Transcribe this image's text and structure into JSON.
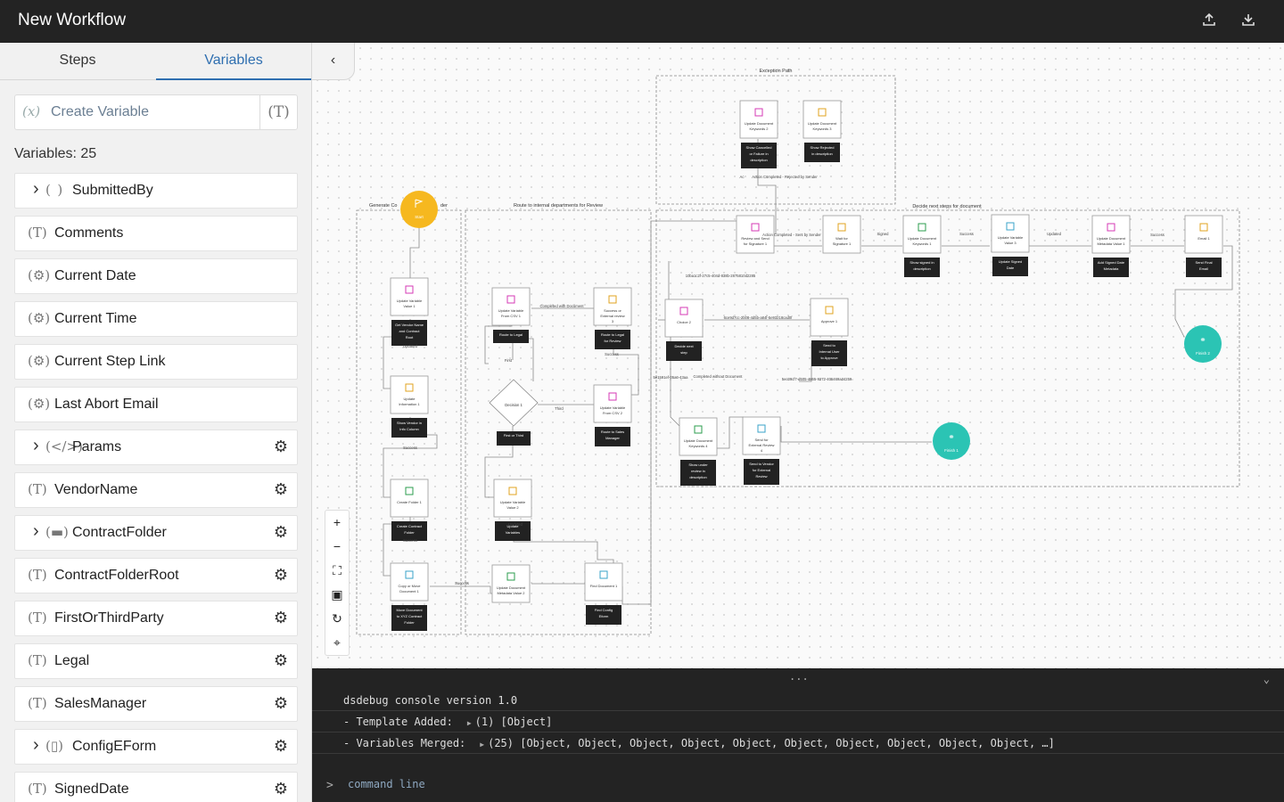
{
  "header": {
    "title": "New Workflow",
    "upload_icon": "upload-icon",
    "download_icon": "download-icon"
  },
  "sidebar": {
    "tabs": [
      {
        "label": "Steps"
      },
      {
        "label": "Variables"
      }
    ],
    "active_tab": "Variables",
    "create_variable": {
      "placeholder": "Create Variable",
      "prefix": "(x)",
      "type_button": "(T)"
    },
    "count_label": "Variables: 25",
    "variables": [
      {
        "name": "SubmittedBy",
        "icon": "( )",
        "icon_name": "person-icon",
        "expandable": true,
        "gear": false
      },
      {
        "name": "Comments",
        "icon": "(T)",
        "icon_name": "text-type-icon",
        "expandable": false,
        "gear": false
      },
      {
        "name": "Current Date",
        "icon": "(⚙)",
        "icon_name": "system-variable-icon",
        "expandable": false,
        "gear": false
      },
      {
        "name": "Current Time",
        "icon": "(⚙)",
        "icon_name": "system-variable-icon",
        "expandable": false,
        "gear": false
      },
      {
        "name": "Current Step Link",
        "icon": "(⚙)",
        "icon_name": "system-variable-icon",
        "expandable": false,
        "gear": false
      },
      {
        "name": "Last Abort Email",
        "icon": "(⚙)",
        "icon_name": "system-variable-icon",
        "expandable": false,
        "gear": false
      },
      {
        "name": "Params",
        "icon": "(</>)",
        "icon_name": "code-icon",
        "expandable": true,
        "gear": true
      },
      {
        "name": "VendorName",
        "icon": "(T)",
        "icon_name": "text-type-icon",
        "expandable": false,
        "gear": true
      },
      {
        "name": "ContractFolder",
        "icon": "(▬)",
        "icon_name": "folder-icon",
        "expandable": true,
        "gear": true
      },
      {
        "name": "ContractFolderRoot",
        "icon": "(T)",
        "icon_name": "text-type-icon",
        "expandable": false,
        "gear": true
      },
      {
        "name": "FirstOrThirdParty",
        "icon": "(T)",
        "icon_name": "text-type-icon",
        "expandable": false,
        "gear": true
      },
      {
        "name": "Legal",
        "icon": "(T)",
        "icon_name": "text-type-icon",
        "expandable": false,
        "gear": true
      },
      {
        "name": "SalesManager",
        "icon": "(T)",
        "icon_name": "text-type-icon",
        "expandable": false,
        "gear": true
      },
      {
        "name": "ConfigEForm",
        "icon": "(▯)",
        "icon_name": "form-icon",
        "expandable": true,
        "gear": true
      },
      {
        "name": "SignedDate",
        "icon": "(T)",
        "icon_name": "text-type-icon",
        "expandable": false,
        "gear": true
      }
    ]
  },
  "canvas": {
    "zoom_controls": [
      {
        "glyph": "+",
        "name": "zoom-in-button"
      },
      {
        "glyph": "−",
        "name": "zoom-out-button"
      },
      {
        "glyph": "⛶",
        "name": "fit-view-button"
      },
      {
        "glyph": "▣",
        "name": "lock-button"
      },
      {
        "glyph": "↻",
        "name": "reset-button"
      },
      {
        "glyph": "⌖",
        "name": "locate-button"
      }
    ],
    "groups": [
      "Exception Path",
      "Generate Co",
      "der",
      "Route to internal departments for Review",
      "Decide next steps for document"
    ],
    "nodes": [
      {
        "title": "Start",
        "desc": ""
      },
      {
        "title": "Update Variable Value 1",
        "desc": "Get Vendor Name and Contract Root"
      },
      {
        "title": "Update Information 1",
        "desc": "Show Vendor in Info Column"
      },
      {
        "title": "Create Folder 1",
        "desc": "Create Contract Folder"
      },
      {
        "title": "Copy or Move Document 1",
        "desc": "Move Document to XYZ Contract Folder"
      },
      {
        "title": "Update Variable From CSV 1",
        "desc": "Route to Legal"
      },
      {
        "title": "Success or External review 3",
        "desc": "Route to Legal for Review"
      },
      {
        "title": "Decision 1",
        "desc": "First or Third"
      },
      {
        "title": "Update Variable From CSV 2",
        "desc": "Route to Sales Manager"
      },
      {
        "title": "Update Variable Value 2",
        "desc": "Update Variables"
      },
      {
        "title": "Update Document Metadata Value 2",
        "desc": ""
      },
      {
        "title": "Find Document 1",
        "desc": "Find Config Eform"
      },
      {
        "title": "Update Document Keywords 2",
        "desc": "Show Cancelled or Failure in description"
      },
      {
        "title": "Update Document Keywords 3",
        "desc": "Show Rejected in description"
      },
      {
        "title": "Review and Send for Signature 1",
        "desc": ""
      },
      {
        "title": "Wait for Signature 1",
        "desc": ""
      },
      {
        "title": "Update Document Keywords 1",
        "desc": "Show signed in description"
      },
      {
        "title": "Update Variable Value 3",
        "desc": "Update Signed Date"
      },
      {
        "title": "Update Document Metadata Value 1",
        "desc": "Add Signed Date Metadata"
      },
      {
        "title": "Email 1",
        "desc": "Send Final Email"
      },
      {
        "title": "Finish 2",
        "desc": ""
      },
      {
        "title": "Choice 2",
        "desc": "Decide next step"
      },
      {
        "title": "Approve 1",
        "desc": "Send to Internal User to Approve"
      },
      {
        "title": "Update Document Keywords 4",
        "desc": "Show under review in description"
      },
      {
        "title": "Send for External Review 4",
        "desc": "Send to Vendor for External Review"
      },
      {
        "title": "Finish 1",
        "desc": ""
      }
    ],
    "edge_labels": [
      "Updated",
      "Success",
      "Success",
      "Success",
      "Completed with Document",
      "First",
      "Third",
      "Success",
      "Updated",
      "Action Completed - Rejected by Sender",
      "Action Completed - Sent by Sender",
      "Signed",
      "Success",
      "Updated",
      "Success",
      "10ba1c2f-27c5-404d-838b-2875810d2285",
      "6ce9d7cc-2b08-4d5b-a84f-5e93218cad0f",
      "5e1591ef-05a6-43aa",
      "Completed without Document",
      "5ec09cf7-d505-4865-9272-405469a34259",
      "Ac"
    ]
  },
  "console": {
    "handle": "...",
    "toggle": "⌄",
    "lines": [
      {
        "label": "dsdebug console version 1.0",
        "value": "",
        "arrow": ""
      },
      {
        "label": "- Template Added:",
        "value": "(1) [Object]",
        "arrow": "▶"
      },
      {
        "label": "- Variables Merged:",
        "value": "(25) [Object, Object, Object, Object, Object, Object, Object, Object, Object, Object, …]",
        "arrow": "▶"
      }
    ],
    "prompt": ">",
    "placeholder": "command line"
  },
  "colors": {
    "topbar": "#232323",
    "accent": "#2f6fb0",
    "start": "#f6b81f",
    "finish": "#2bc4b4",
    "console": "#232323"
  }
}
